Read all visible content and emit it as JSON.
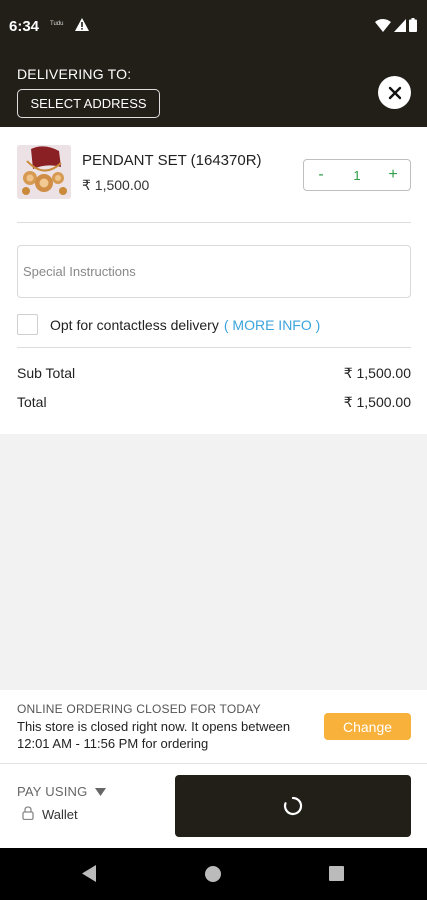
{
  "status_bar": {
    "time": "6:34",
    "mini_text": "Tudu"
  },
  "header": {
    "delivering_label": "DELIVERING TO:",
    "select_address_label": "SELECT ADDRESS"
  },
  "cart": {
    "item": {
      "name": "PENDANT SET (164370R)",
      "price": "₹ 1,500.00",
      "quantity": "1",
      "minus": "-",
      "plus": "+"
    },
    "special_instructions_placeholder": "Special Instructions",
    "contactless_label": "Opt for contactless delivery",
    "more_info_label": "( MORE INFO )",
    "subtotal_label": "Sub Total",
    "subtotal_value": "₹ 1,500.00",
    "total_label": "Total",
    "total_value": "₹ 1,500.00"
  },
  "notice": {
    "title": "ONLINE ORDERING CLOSED FOR TODAY",
    "message": "This store is closed right now. It opens between 12:01 AM - 11:56 PM for ordering",
    "change_label": "Change"
  },
  "payment": {
    "pay_using_label": "PAY USING",
    "method": "Wallet"
  },
  "colors": {
    "header_bg": "#221f19",
    "accent_green": "#2e9e48",
    "link_blue": "#3aa4dd",
    "change_orange": "#f8b13a"
  }
}
